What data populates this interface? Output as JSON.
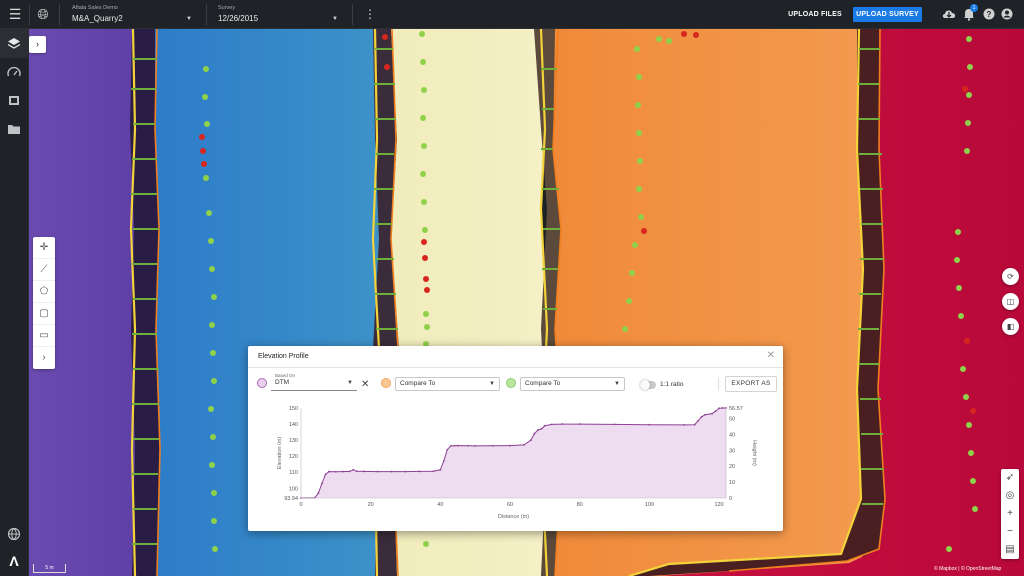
{
  "topbar": {
    "menu_icon": "hamburger-menu-icon",
    "globe_icon": "globe-icon",
    "org_label": "Aftata Sales Demo",
    "site_value": "M&A_Quarry2",
    "survey_label": "Survey",
    "survey_value": "12/26/2015",
    "more_icon": "vertical-dots-icon",
    "upload_files": "UPLOAD FILES",
    "upload_survey": "UPLOAD SURVEY",
    "notification_count": "1",
    "accent": "#1a7ae6"
  },
  "sidebar": {
    "items": [
      "layers-icon",
      "gauge-icon",
      "gallery-icon",
      "folder-icon"
    ],
    "bottom": [
      "language-icon",
      "logo-mark"
    ],
    "logo": "Λ"
  },
  "map": {
    "scale": "5 m",
    "attribution": "© Mapbox | © OpenStreetMap"
  },
  "panel": {
    "title": "Elevation Profile",
    "based_on_label": "Based On",
    "based_on_value": "DTM",
    "compare_1": "Compare To",
    "compare_2": "Compare To",
    "ratio_label": "1:1 ratio",
    "export_label": "EXPORT AS",
    "colors": {
      "dtm": "#b26bb8",
      "compare_1": "#f5a45a",
      "compare_2": "#8fd16b"
    }
  },
  "chart_data": {
    "type": "area",
    "xlabel": "Distance (m)",
    "ylabel": "Elevation (m)",
    "y2label": "Height (m)",
    "xlim": [
      0,
      122
    ],
    "ylim": [
      93.94,
      150
    ],
    "y2lim": [
      0,
      56.57
    ],
    "x_ticks": [
      0,
      20,
      40,
      60,
      80,
      100,
      120
    ],
    "y_ticks": [
      93.94,
      100,
      110,
      120,
      130,
      140,
      150
    ],
    "y_tick_labels": [
      "93.94",
      "100",
      "110",
      "120",
      "130",
      "140",
      "150"
    ],
    "y2_ticks": [
      0,
      10,
      20,
      30,
      40,
      50,
      56.57
    ],
    "y2_tick_labels": [
      "0",
      "10",
      "20",
      "30",
      "40",
      "50",
      "56.57"
    ],
    "series": [
      {
        "x": [
          0,
          4,
          5,
          6,
          7,
          8,
          10,
          12,
          14,
          15,
          16,
          18,
          22,
          26,
          30,
          34,
          38,
          40,
          41,
          42,
          43,
          44,
          45,
          48,
          50,
          55,
          60,
          64,
          66,
          67,
          68,
          69,
          70,
          72,
          75,
          80,
          90,
          100,
          110,
          113,
          114,
          115,
          116,
          118,
          119,
          120,
          121,
          122
        ],
        "y": [
          93.94,
          94.1,
          97,
          103,
          108.5,
          110.4,
          110.3,
          110.4,
          110.5,
          111.5,
          110.6,
          110.5,
          110.4,
          110.4,
          110.4,
          110.5,
          110.6,
          111.5,
          117,
          124,
          126.4,
          126.5,
          126.6,
          126.5,
          126.4,
          126.5,
          126.6,
          127,
          130,
          134,
          136.3,
          137,
          139,
          139.8,
          140,
          140,
          139.8,
          139.6,
          139.5,
          139.6,
          142,
          144.5,
          145.8,
          146.5,
          148,
          149.8,
          150,
          150
        ]
      }
    ]
  }
}
